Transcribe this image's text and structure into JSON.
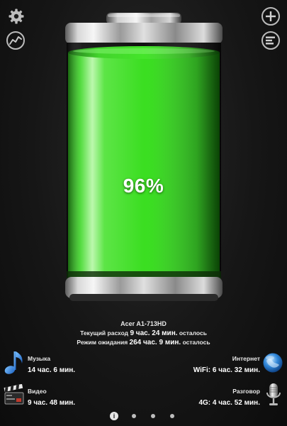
{
  "toolbar": {
    "settings_icon": "gear-icon",
    "graph_icon": "graph-line-icon",
    "add_icon": "plus-icon",
    "list_icon": "list-icon"
  },
  "battery": {
    "level_percent": 96,
    "percent_label": "96%",
    "fill_color": "#22e010",
    "status": "charging"
  },
  "device": {
    "name": "Acer A1-713HD",
    "current_usage_prefix": "Текущий расход",
    "current_usage_value": "9 час. 24 мин.",
    "current_usage_suffix": "осталось",
    "standby_prefix": "Режим ожидания",
    "standby_value": "264 час. 9 мин.",
    "standby_suffix": "осталось"
  },
  "stats": {
    "music": {
      "label": "Музыка",
      "value": "14 час. 6 мин.",
      "icon": "music-note-icon"
    },
    "internet": {
      "label": "Интернет",
      "value": "WiFi: 6 час. 32 мин.",
      "icon": "globe-icon"
    },
    "video": {
      "label": "Видео",
      "value": "9 час. 48 мин.",
      "icon": "clapperboard-icon"
    },
    "talk": {
      "label": "Разговор",
      "value": "4G: 4 час. 52 мин.",
      "icon": "microphone-icon"
    }
  },
  "pagination": {
    "active_index": 0,
    "active_marker": "i",
    "total": 4
  }
}
